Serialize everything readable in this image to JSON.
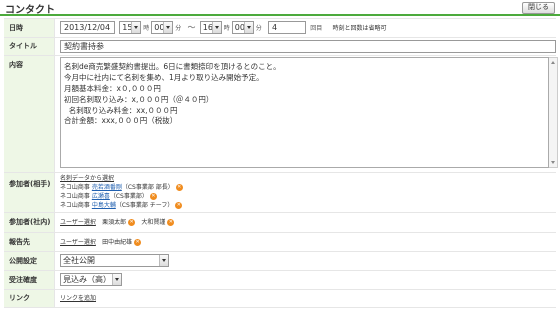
{
  "header": {
    "title": "コンタクト",
    "close_label": "閉じる"
  },
  "datetime": {
    "label": "日時",
    "date": "2013/12/04",
    "start_hour": "15",
    "hour_unit": "時",
    "start_minute": "00",
    "minute_unit": "分",
    "tilde": "～",
    "end_hour": "16",
    "end_minute": "00",
    "count_value": "4",
    "count_unit": "回目",
    "note": "時刻と回数は省略可"
  },
  "title_field": {
    "label": "タイトル",
    "value": "契約書持参"
  },
  "body_field": {
    "label": "内容",
    "lines": [
      "名刺de商売繁盛契約書提出。6日に書類捺印を頂けるとのこと。",
      "",
      "今月中に社内にて名刺を集め、1月より取り込み開始予定。",
      "",
      "月額基本料金：x０,０００円",
      "初回名刺取り込み：x,０００円（＠４０円）",
      "  名刺取り込み料金：xx,０００円",
      "",
      "合計金額：xxx,０００円（税抜）"
    ]
  },
  "participants_client": {
    "label": "参加者(相手)",
    "select_link": "名刺データから選択",
    "entries": [
      {
        "company": "ネコ山商事",
        "name": "売若酒番剛",
        "detail": "（CS事業部 部長）"
      },
      {
        "company": "ネコ山商事",
        "name": "広瀬喜",
        "detail": "（CS事業部）"
      },
      {
        "company": "ネコ山商事",
        "name": "中島大輔",
        "detail": "（CS事業部 チーフ）"
      }
    ]
  },
  "participants_internal": {
    "label": "参加者(社内)",
    "select_link": "ユーザー選択",
    "users": [
      "栗須太郎",
      "大和賢謹"
    ]
  },
  "report_to": {
    "label": "報告先",
    "select_link": "ユーザー選択",
    "users": [
      "田中由紀雄"
    ]
  },
  "visibility": {
    "label": "公開設定",
    "value": "全社公開"
  },
  "probability": {
    "label": "受注確度",
    "value": "見込み（高）"
  },
  "link_field": {
    "label": "リンク",
    "add_link": "リンクを追加"
  },
  "icons": {
    "remove": "x-icon",
    "dropdown": "chevron-down-icon"
  },
  "colors": {
    "accent": "#4caa3c",
    "label_bg": "#eef7e6",
    "link_orange": "#e87b16",
    "remove_orange": "#f08c1e"
  }
}
